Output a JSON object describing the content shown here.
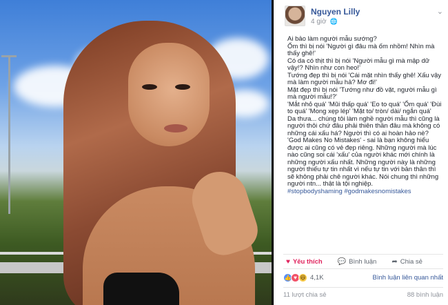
{
  "post": {
    "author": "Nguyen Lilly",
    "time": "4 giờ",
    "paragraphs": [
      "Ai bảo làm người mẫu sướng?",
      "Ốm thì bị nói 'Người gì đâu mà ốm nhồm! Nhìn mà thấy ghê!'",
      "Có da có thịt thì bị nói 'Người mẫu gì mà mập dữ vậy!? Nhìn như con heo!'",
      "Tướng đẹp thì bị nói 'Cái mặt nhìn thấy ghê! Xấu vậy mà làm người mẫu hả? Mơ đi!'",
      "Mặt đẹp thì bị nói 'Tướng như đồ vặt, người mẫu gì mà người mẫu!?'",
      "'Mắt nhỏ quá' 'Mũi thấp quá' 'Eo to quá' 'Ốm quá' 'Đùi to quá' 'Mong xẹp lép' 'Mặt to/ tròn/ dài/ ngắn quá'",
      "Da thưa... chúng tôi làm nghề người mẫu thì cũng là người thôi chứ đâu phải thiên thần đâu mà không có những cái xấu há? Người thì có ai hoàn hảo nè? 'God Makes No Mistakes' - sai là bạn không hiểu được ai cũng có vẻ đẹp riêng. Những người mà lúc nào cũng soi cái 'xấu' của người khác mới chính là những người xấu nhất. Những người này là những người thiếu tự tin nhất vì nếu tự tin với bản thân thì sẽ không phải chê người khác. Nói chung thì những người ntn... thật là tội nghiệp."
    ],
    "hashtags": "#stopbodyshaming #godmakesnomistakes"
  },
  "actions": {
    "like": "Yêu thích",
    "comment": "Bình luận",
    "share": "Chia sẻ"
  },
  "reactions": {
    "count": "4,1K",
    "sort_label": "Bình luận liên quan nhất"
  },
  "footer": {
    "shares": "11 lượt chia sẻ",
    "views": "88 bình luận"
  },
  "icons": {
    "like": "like-icon",
    "heart": "heart-icon",
    "haha": "haha-icon",
    "comment": "comment-icon",
    "share": "share-icon",
    "chevron": "chevron-down-icon",
    "globe": "globe-icon"
  },
  "colors": {
    "link": "#365899",
    "liked": "#e0245e",
    "text": "#1d2129",
    "muted": "#90949c"
  }
}
